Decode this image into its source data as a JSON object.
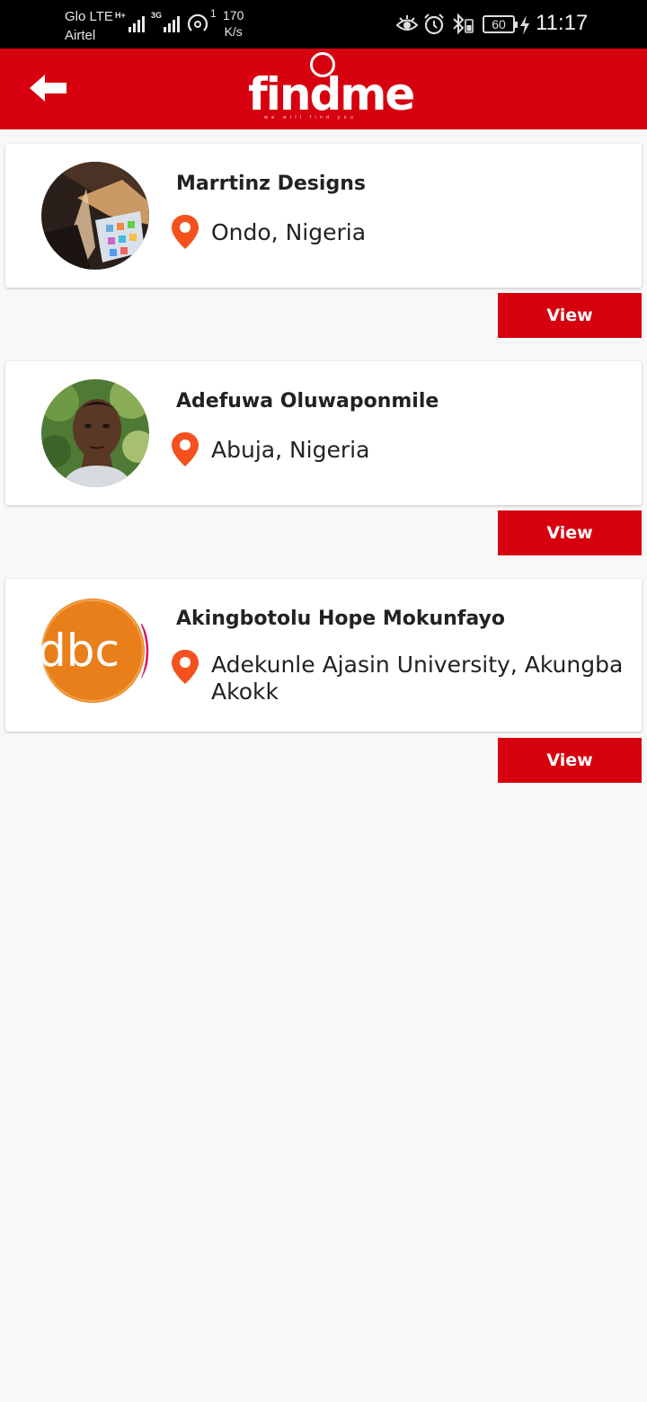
{
  "status_bar": {
    "carrier_1": "Glo LTE",
    "carrier_2": "Airtel",
    "net_type_1": "H+",
    "net_type_2": "3G",
    "hotspot_count": "1",
    "speed_value": "170",
    "speed_unit": "K/s",
    "battery": "60",
    "time": "11:17",
    "icons": [
      "eye-comfort-icon",
      "alarm-icon",
      "bluetooth-icon",
      "battery-icon",
      "charging-icon"
    ]
  },
  "app_bar": {
    "logo_text": "findme",
    "logo_tagline": "we will find you",
    "back_icon": "back-arrow-icon",
    "color": "#d6000f"
  },
  "results": [
    {
      "name": "Marrtinz Designs",
      "location": "Ondo, Nigeria",
      "button": "View",
      "avatar": "photo-laptop"
    },
    {
      "name": "Adefuwa Oluwaponmile",
      "location": "Abuja, Nigeria",
      "button": "View",
      "avatar": "photo-portrait"
    },
    {
      "name": "Akingbotolu Hope Mokunfayo",
      "location": "Adekunle Ajasin University, Akungba Akokk",
      "button": "View",
      "avatar": "dbc-logo"
    }
  ],
  "avatar_logo_text": "dbc",
  "colors": {
    "accent": "#d6000f",
    "pin": "#f4511e",
    "background": "#f8f8f8"
  }
}
